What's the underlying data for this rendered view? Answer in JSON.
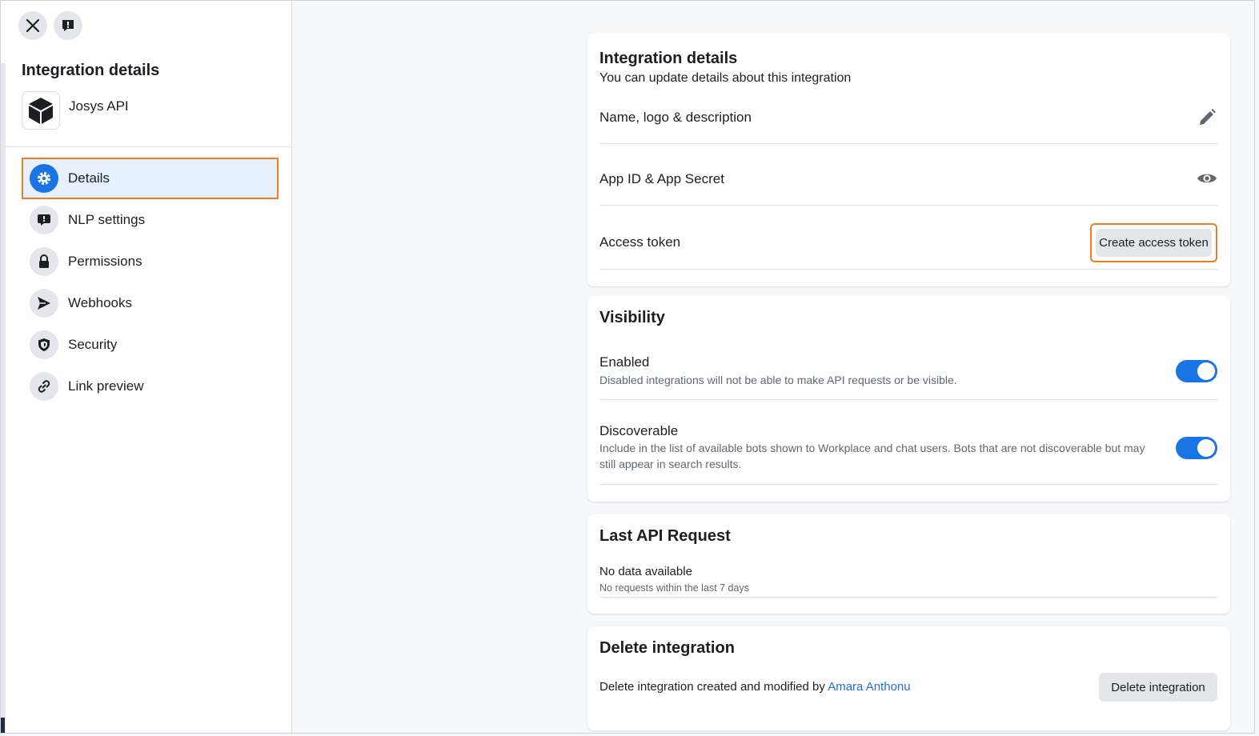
{
  "sidebar": {
    "title": "Integration details",
    "app_name": "Josys API",
    "items": [
      {
        "label": "Details",
        "icon": "gear-icon",
        "active": true
      },
      {
        "label": "NLP settings",
        "icon": "speech-bubble-icon",
        "active": false
      },
      {
        "label": "Permissions",
        "icon": "lock-icon",
        "active": false
      },
      {
        "label": "Webhooks",
        "icon": "send-icon",
        "active": false
      },
      {
        "label": "Security",
        "icon": "shield-icon",
        "active": false
      },
      {
        "label": "Link preview",
        "icon": "link-icon",
        "active": false
      }
    ]
  },
  "details_card": {
    "title": "Integration details",
    "subtitle": "You can update details about this integration",
    "name_row_label": "Name, logo & description",
    "app_id_row_label": "App ID & App Secret",
    "access_token_label": "Access token",
    "create_token_button": "Create access token"
  },
  "visibility_card": {
    "title": "Visibility",
    "enabled_label": "Enabled",
    "enabled_desc": "Disabled integrations will not be able to make API requests or be visible.",
    "enabled_on": true,
    "discoverable_label": "Discoverable",
    "discoverable_desc": "Include in the list of available bots shown to Workplace and chat users. Bots that are not discoverable but may still appear in search results.",
    "discoverable_on": true
  },
  "api_card": {
    "title": "Last API Request",
    "status": "No data available",
    "detail": "No requests within the last 7 days"
  },
  "delete_card": {
    "title": "Delete integration",
    "text_prefix": "Delete integration created and modified by",
    "author": "Amara Anthonu",
    "button": "Delete integration"
  },
  "colors": {
    "accent_blue": "#1b74e4",
    "highlight_orange": "#f07b23",
    "link_blue": "#216fdb"
  }
}
